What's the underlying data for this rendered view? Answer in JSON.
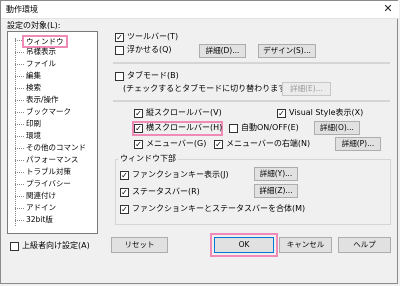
{
  "window": {
    "title": "動作環境",
    "close_glyph": "✕"
  },
  "settings_label": "設定の対象(L):",
  "tree": {
    "items": [
      "ウィンドウ",
      "吊様表示",
      "ファイル",
      "編集",
      "検索",
      "表示/操作",
      "ブックマーク",
      "印刷",
      "環境",
      "その他のコマンド",
      "パフォーマンス",
      "トラブル対策",
      "プライバシー",
      "関連付け",
      "アドイン",
      "32bit版"
    ],
    "selected": "ウィンドウ"
  },
  "toolbar": {
    "label": "ツールバー(T)",
    "checked": true,
    "float": {
      "label": "浮かせる(Q)",
      "checked": false
    },
    "details_button": "詳細(D)...",
    "design_button": "デザイン(S)..."
  },
  "tab_mode": {
    "label": "タブモード(B)",
    "checked": false,
    "note": "(チェックするとタブモードに切り替わります)",
    "details_button": "詳細(E)..."
  },
  "vscroll": {
    "label": "縦スクロールバー(V)",
    "checked": true
  },
  "visual_style": {
    "label": "Visual Style表示(X)",
    "checked": true
  },
  "hscroll": {
    "label": "横スクロールバー(H)",
    "checked": true
  },
  "auto_onoff": {
    "label": "自動ON/OFF(E)",
    "checked": false
  },
  "hscroll_details_button": "詳細(O)...",
  "menubar": {
    "label": "メニューバー(G)",
    "checked": true
  },
  "menubar_right": {
    "label": "メニューバーの右端(N)",
    "checked": true
  },
  "menubar_details_button": "詳細(P)...",
  "bottom_section": {
    "title": "ウィンドウ下部",
    "function_key": {
      "label": "ファンクションキー表示(J)",
      "checked": true,
      "details_button": "詳細(Y)..."
    },
    "statusbar": {
      "label": "ステータスバー(R)",
      "checked": true,
      "details_button": "詳細(Z)..."
    },
    "merge": {
      "label": "ファンクションキーとステータスバーを合体(M)",
      "checked": true
    }
  },
  "advanced": {
    "label": "上級者向け設定(A)",
    "checked": false
  },
  "buttons": {
    "reset": "リセット",
    "ok": "OK",
    "cancel": "キャンセル",
    "help": "ヘルプ"
  },
  "check_glyph": "✓",
  "colors": {
    "highlight": "#f08ab6"
  }
}
